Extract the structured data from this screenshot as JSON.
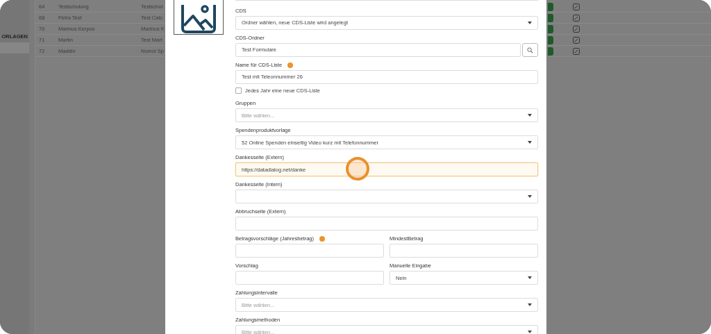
{
  "sidebar": {
    "heading": "ORLAGEN",
    "items": [
      {
        "selected": false
      },
      {
        "selected": true
      }
    ]
  },
  "table": {
    "rows": [
      {
        "id": "64",
        "name": "Testschulung",
        "column_3": "Testschul",
        "active": true
      },
      {
        "id": "68",
        "name": "Petra Test",
        "column_3": "Test Catc",
        "active": true
      },
      {
        "id": "70",
        "name": "Marinus Kerpus",
        "column_3": "Marinus K",
        "active": true
      },
      {
        "id": "71",
        "name": "Martin",
        "column_3": "Test Mart",
        "active": true
      },
      {
        "id": "72",
        "name": "Maddin",
        "column_3": "Nomoi Sp",
        "active": true
      }
    ]
  },
  "form": {
    "fields": [
      {
        "kind": "select",
        "label": "CDS",
        "value": "Ordner wählen, neue CDS-Liste wird angelegt",
        "info": false,
        "focused": false
      },
      {
        "kind": "search",
        "label": "CDS-Ordner",
        "value": "Test Formulare",
        "info": false,
        "focused": false
      },
      {
        "kind": "input",
        "label": "Name für CDS-Liste",
        "value": "Test mit Teleonnummer 26",
        "info": true,
        "focused": false
      },
      {
        "kind": "checkbox",
        "label": "Jedes Jahr eine neue CDS-Liste",
        "checked": false
      },
      {
        "kind": "select",
        "label": "Gruppen",
        "placeholder": "Bitte wählen...",
        "info": false,
        "focused": false
      },
      {
        "kind": "select",
        "label": "Spendenproduktvorlage",
        "value": "52 Online Spenden einseitig Video kurz mit Telefonnummer",
        "info": false,
        "focused": false
      },
      {
        "kind": "input",
        "label": "Dankesseite (Extern)",
        "value": "https://datadialog.net/danke",
        "info": false,
        "focused": true
      },
      {
        "kind": "select",
        "label": "Dankesseite (Intern)",
        "info": false,
        "focused": false
      },
      {
        "kind": "input",
        "label": "Abbruchseite (Extern)",
        "info": false,
        "focused": false
      },
      {
        "kind": "pair",
        "fields": [
          {
            "kind": "input",
            "label": "Betragsvorschläge (Jahresbetrag)",
            "info": true,
            "focused": false
          },
          {
            "kind": "input",
            "label": "MindestBetrag",
            "info": false,
            "focused": false
          }
        ]
      },
      {
        "kind": "pair",
        "fields": [
          {
            "kind": "input",
            "label": "Vorschlag",
            "info": false,
            "focused": false
          },
          {
            "kind": "select",
            "label": "Manuelle Eingabe",
            "value": "Nein",
            "info": false,
            "focused": false
          }
        ]
      },
      {
        "kind": "select",
        "label": "Zahlungsintervalle",
        "placeholder": "Bitte wählen...",
        "info": false,
        "focused": false
      },
      {
        "kind": "select",
        "label": "Zahlungsmethoden",
        "placeholder": "Bitte wählen...",
        "info": false,
        "focused": false
      }
    ]
  }
}
